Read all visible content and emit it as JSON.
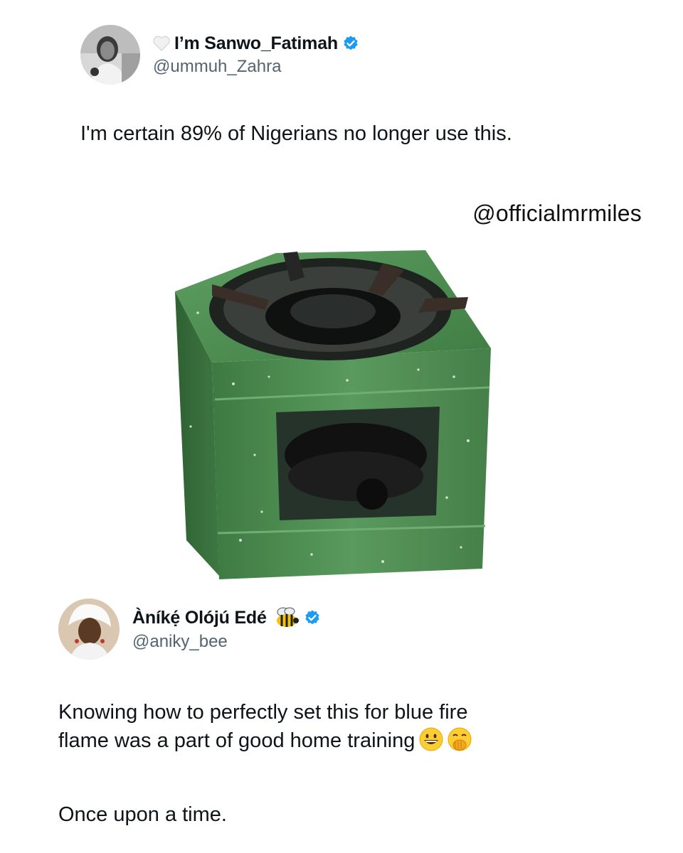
{
  "tweet1": {
    "display_name": "I’m Sanwo_Fatimah",
    "handle": "@ummuh_Zahra",
    "text": "I'm certain 89% of Nigerians no longer use this."
  },
  "watermark": "@officialmrmiles",
  "tweet2": {
    "display_name": "Àníkẹ́ Olójú Edé",
    "handle": "@aniky_bee",
    "text_line1": "Knowing how to perfectly set this for blue fire",
    "text_line2": "flame was a part of good home training",
    "text_line3": "Once upon a time."
  },
  "colors": {
    "verified": "#1d9bf0",
    "stove_green": "#4b8a4f",
    "handle": "#536471"
  }
}
